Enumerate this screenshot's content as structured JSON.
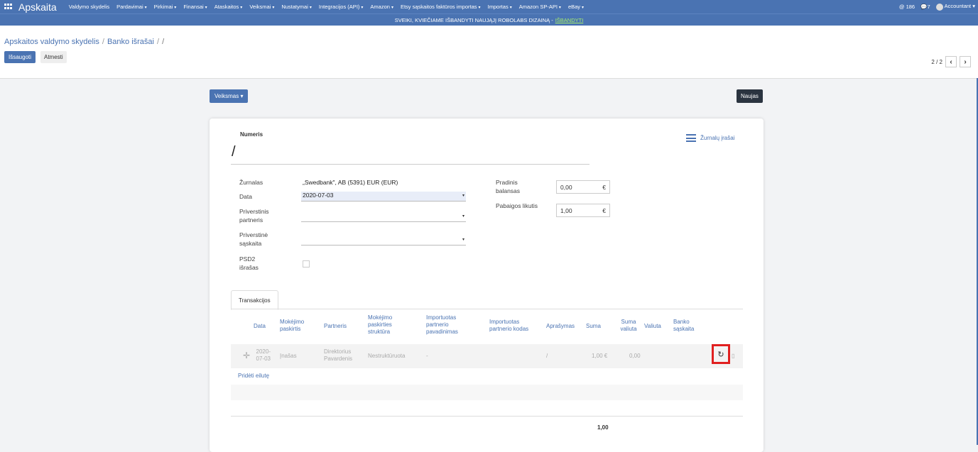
{
  "app": {
    "title": "Apskaita",
    "menu": [
      "Valdymo skydelis",
      "Pardavimai",
      "Pirkimai",
      "Finansai",
      "Ataskaitos",
      "Veiksmai",
      "Nustatymai",
      "Integracijos (API)",
      "Amazon",
      "Etsy sąskaitos faktūros importas",
      "Importas",
      "Amazon SP-API",
      "eBay"
    ],
    "notifications": "186",
    "messages": "7",
    "user": "Accountant"
  },
  "banner": {
    "text": "SVEIKI, KVIEČIAME IŠBANDYTI NAUJĄJĮ ROBOLABS DIZAINĄ -",
    "link": "IŠBANDYTI"
  },
  "breadcrumb": {
    "root": "Apskaitos valdymo skydelis",
    "middle": "Banko išrašai",
    "current": "/"
  },
  "buttons": {
    "save": "Išsaugoti",
    "discard": "Atmesti",
    "action": "Veiksmas",
    "new": "Naujas"
  },
  "pager": {
    "text": "2 / 2"
  },
  "form": {
    "number_label": "Numeris",
    "number_value": "/",
    "journal_entries_btn": "Žurnalų įrašai",
    "journal_label": "Žurnalas",
    "journal_value": "„Swedbank\", AB (5391) EUR (EUR)",
    "date_label": "Data",
    "date_value": "2020-07-03",
    "forced_partner_label": "Priverstinis partneris",
    "forced_account_label": "Priverstinė sąskaita",
    "psd2_label": "PSD2 išrašas",
    "start_balance_label": "Pradinis balansas",
    "start_balance_value": "0,00",
    "end_balance_label": "Pabaigos likutis",
    "end_balance_value": "1,00",
    "currency_symbol": "€"
  },
  "tabs": {
    "transactions": "Transakcijos"
  },
  "table": {
    "headers": [
      "Data",
      "Mokėjimo paskirtis",
      "Partneris",
      "Mokėjimo paskirties struktūra",
      "Importuotas partnerio pavadinimas",
      "Importuotas partnerio kodas",
      "Aprašymas",
      "Suma",
      "Suma valiuta",
      "Valiuta",
      "Banko sąskaita"
    ],
    "row": {
      "date": "2020-07-03",
      "purpose": "Įnašas",
      "partner": "Direktorius Pavardenis",
      "structure": "Nestruktūruota",
      "imported_name": "-",
      "description": "/",
      "amount": "1,00 €",
      "amount_currency": "0,00"
    },
    "add_line": "Pridėti eilutę",
    "total": "1,00"
  }
}
